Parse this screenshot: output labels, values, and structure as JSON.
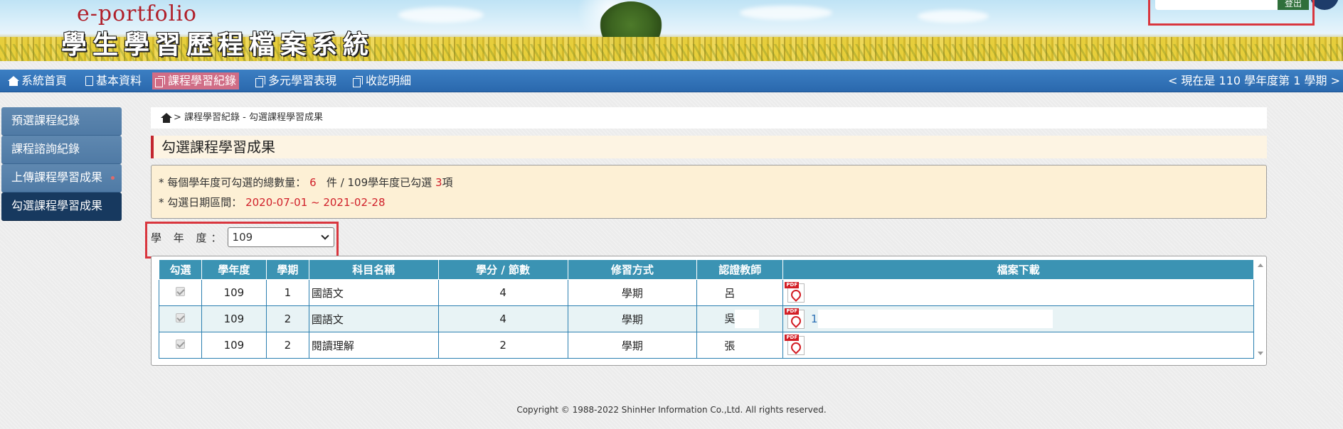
{
  "header": {
    "brand_en": "e-portfolio",
    "brand_zh": "學生學習歷程檔案系統",
    "logout_label": "登出"
  },
  "nav": {
    "items": [
      {
        "label": "系統首頁",
        "icon": "home-icon"
      },
      {
        "label": "基本資料",
        "icon": "document-icon"
      },
      {
        "label": "課程學習紀錄",
        "icon": "copy-icon",
        "active": true
      },
      {
        "label": "多元學習表現",
        "icon": "copy-icon"
      },
      {
        "label": "收訖明細",
        "icon": "copy-icon"
      }
    ],
    "term_info": "< 現在是 110 學年度第 1 學期 >"
  },
  "sidebar": {
    "items": [
      {
        "label": "預選課程紀錄"
      },
      {
        "label": "課程諮詢紀錄"
      },
      {
        "label": "上傳課程學習成果"
      },
      {
        "label": "勾選課程學習成果",
        "active": true
      }
    ]
  },
  "breadcrumb": "> 課程學習紀錄 - 勾選課程學習成果",
  "page_title": "勾選課程學習成果",
  "notice": {
    "line1_prefix": "* 每個學年度可勾選的總數量：",
    "line1_total": "6",
    "line1_mid": "件 / 109學年度已勾選",
    "line1_selected": "3",
    "line1_suffix": "項",
    "line2_prefix": "* 勾選日期區間：",
    "line2_range": "2020-07-01 ~ 2021-02-28"
  },
  "year_filter": {
    "label": "學 年 度：",
    "value": "109"
  },
  "table": {
    "headers": [
      "勾選",
      "學年度",
      "學期",
      "科目名稱",
      "學分 / 節數",
      "修習方式",
      "認證教師",
      "檔案下載"
    ],
    "rows": [
      {
        "year": "109",
        "term": "1",
        "subject": "國語文",
        "credits": "4",
        "method": "學期",
        "teacher": "呂",
        "file": ""
      },
      {
        "year": "109",
        "term": "2",
        "subject": "國語文",
        "credits": "4",
        "method": "學期",
        "teacher": "吳",
        "file": "1"
      },
      {
        "year": "109",
        "term": "2",
        "subject": "閱讀理解",
        "credits": "2",
        "method": "學期",
        "teacher": "張",
        "file": ""
      }
    ]
  },
  "footer": {
    "copyright": "Copyright © 1988-2022 ShinHer Information Co.,Ltd. All rights reserved."
  },
  "colors": {
    "nav_bg": "#2f6fb3",
    "nav_active": "#d06d86",
    "sidebar_active": "#17395f",
    "table_header": "#3b93b3",
    "highlight_red": "#d0202a"
  }
}
